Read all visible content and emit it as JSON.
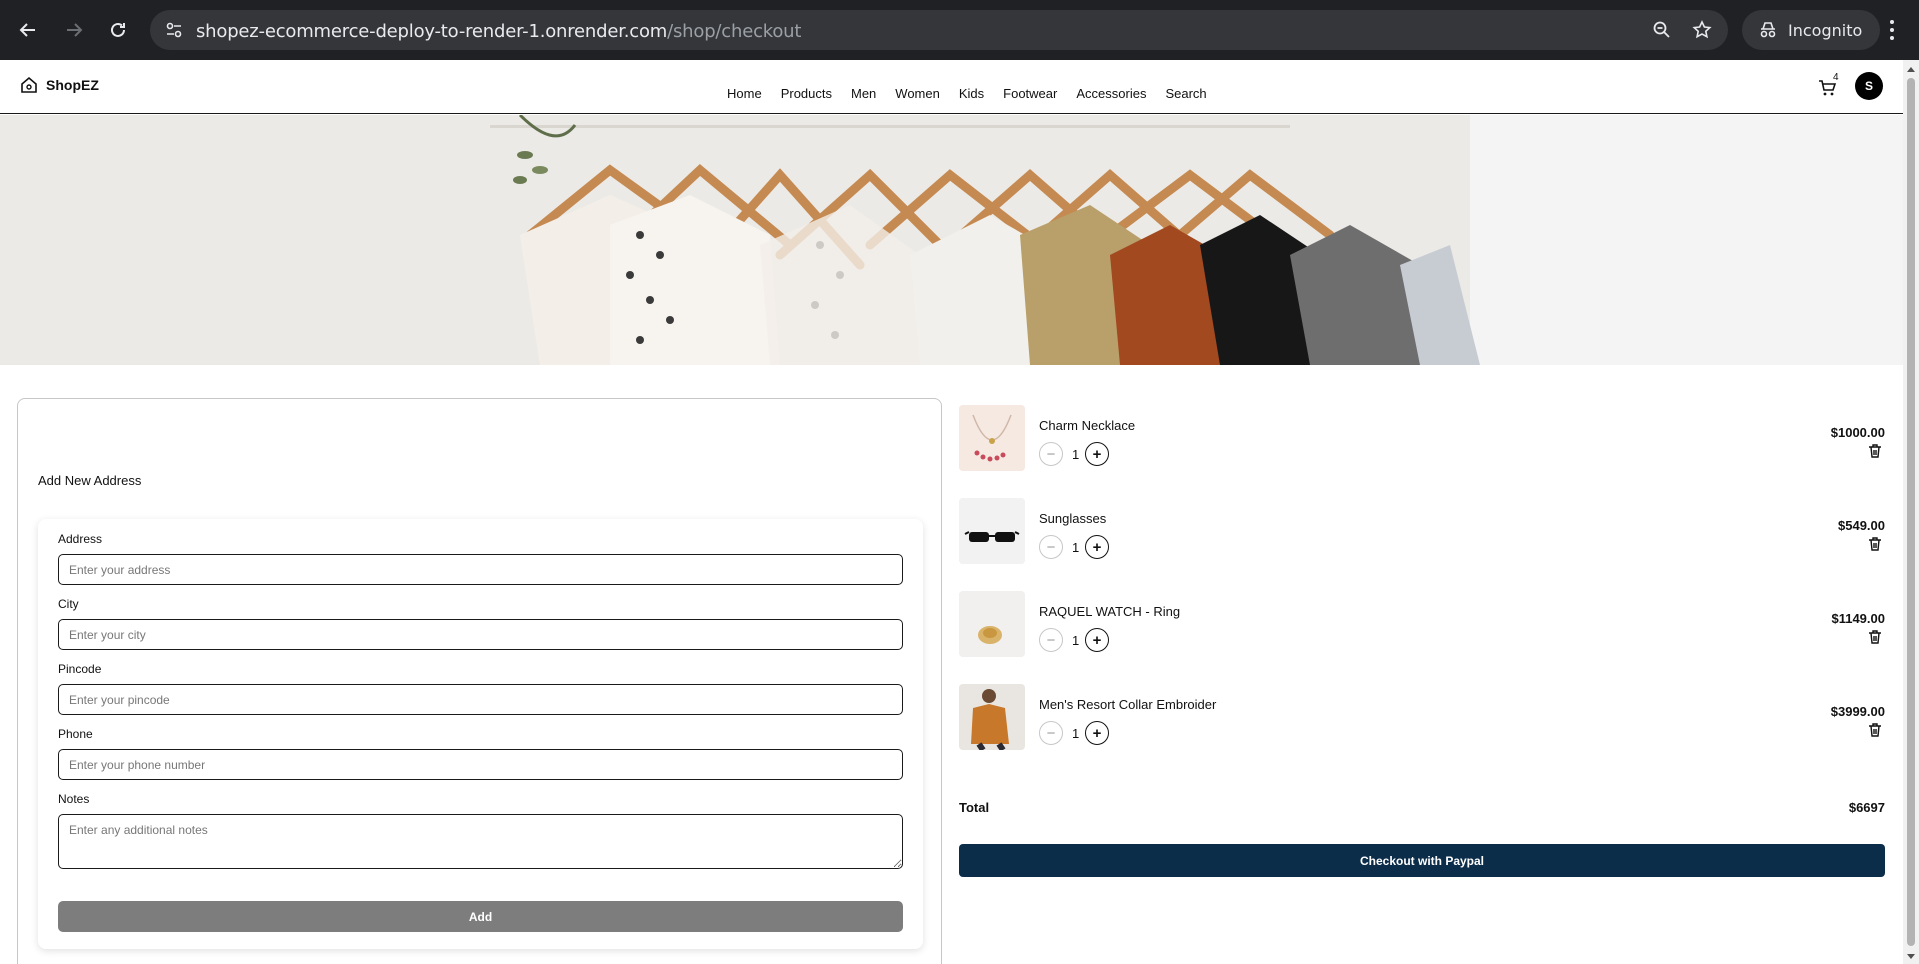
{
  "browser": {
    "url_host": "shopez-ecommerce-deploy-to-render-1.onrender.com",
    "url_path": "/shop/checkout",
    "incognito_label": "Incognito"
  },
  "header": {
    "brand": "ShopEZ",
    "nav": [
      "Home",
      "Products",
      "Men",
      "Women",
      "Kids",
      "Footwear",
      "Accessories",
      "Search"
    ],
    "cart_count": "4",
    "avatar_initial": "S"
  },
  "address": {
    "title": "Add New Address",
    "fields": {
      "address": {
        "label": "Address",
        "placeholder": "Enter your address"
      },
      "city": {
        "label": "City",
        "placeholder": "Enter your city"
      },
      "pincode": {
        "label": "Pincode",
        "placeholder": "Enter your pincode"
      },
      "phone": {
        "label": "Phone",
        "placeholder": "Enter your phone number"
      },
      "notes": {
        "label": "Notes",
        "placeholder": "Enter any additional notes"
      }
    },
    "add_label": "Add"
  },
  "cart": {
    "items": [
      {
        "name": "Charm Necklace",
        "qty": "1",
        "price": "$1000.00"
      },
      {
        "name": "Sunglasses",
        "qty": "1",
        "price": "$549.00"
      },
      {
        "name": "RAQUEL WATCH - Ring",
        "qty": "1",
        "price": "$1149.00"
      },
      {
        "name": "Men's Resort Collar Embroider",
        "qty": "1",
        "price": "$3999.00"
      }
    ],
    "total_label": "Total",
    "total_value": "$6697",
    "checkout_label": "Checkout with Paypal"
  },
  "colors": {
    "checkout_bg": "#0b2d4a",
    "add_button_bg": "#7d7d7d",
    "chrome_bg": "#202124"
  }
}
